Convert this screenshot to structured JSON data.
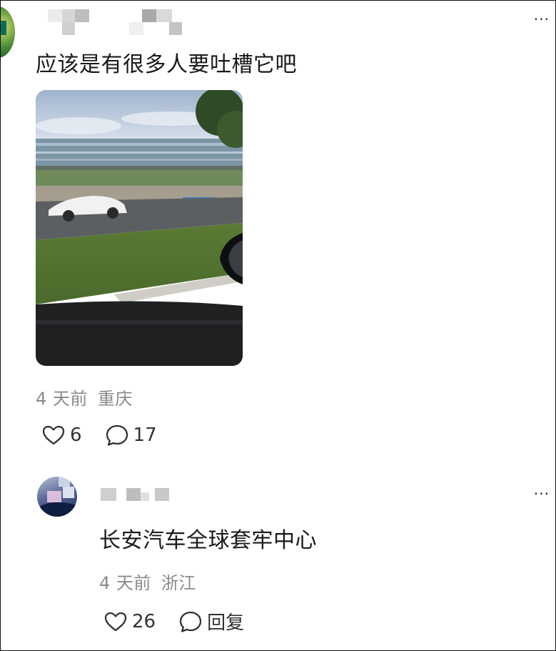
{
  "comments": [
    {
      "text": "应该是有很多人要吐槽它吧",
      "time": "4 天前",
      "location": "重庆",
      "likes": "6",
      "replies": "17",
      "has_photo": true,
      "more_icon": "more-dots-icon"
    },
    {
      "text": "长安汽车全球套牢中心",
      "time": "4 天前",
      "location": "浙江",
      "likes": "26",
      "reply_label": "回复",
      "more_icon": "more-dots-icon"
    }
  ],
  "icons": {
    "like": "heart-icon",
    "comment": "comment-bubble-icon"
  },
  "colors": {
    "text": "#1a1a1a",
    "meta": "#8a8a8a",
    "icon": "#333333"
  }
}
